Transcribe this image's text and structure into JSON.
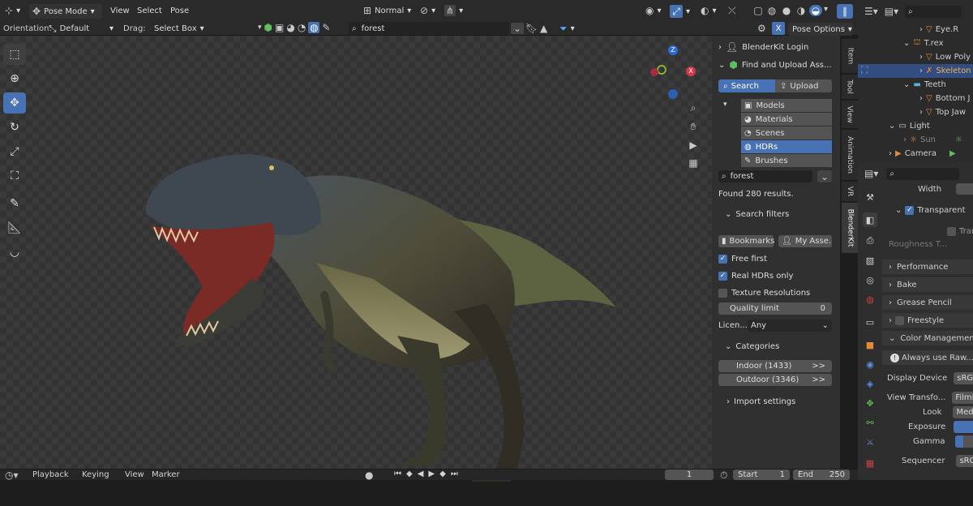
{
  "header": {
    "mode": "Pose Mode",
    "menus": [
      "View",
      "Select",
      "Pose"
    ],
    "orientation_label": "Orientation:",
    "orientation_value": "Default",
    "drag_label": "Drag:",
    "drag_value": "Select Box",
    "transform_orientation": "Normal",
    "pose_options": "Pose Options",
    "search_value": "forest"
  },
  "blenderkit": {
    "login": "BlenderKit Login",
    "find_title": "Find and Upload Ass...",
    "search_tab": "Search",
    "upload_tab": "Upload",
    "categories": [
      {
        "label": "Models",
        "icon": "cube-icon"
      },
      {
        "label": "Materials",
        "icon": "sphere-icon"
      },
      {
        "label": "Scenes",
        "icon": "scene-icon"
      },
      {
        "label": "HDRs",
        "icon": "world-icon"
      },
      {
        "label": "Brushes",
        "icon": "brush-icon"
      }
    ],
    "selected_category": "HDRs",
    "search_value": "forest",
    "results": "Found 280 results.",
    "search_filters": "Search filters",
    "bookmarks": "Bookmarks",
    "my_assets": "My Asse...",
    "free_first": "Free first",
    "real_hdrs": "Real HDRs only",
    "texture_res": "Texture Resolutions",
    "quality_label": "Quality limit",
    "quality_value": "0",
    "license_label": "Licen...",
    "license_value": "Any",
    "categories_header": "Categories",
    "cat_buttons": [
      {
        "label": "Indoor (1433)",
        "arrow": ">>"
      },
      {
        "label": "Outdoor (3346)",
        "arrow": ">>"
      }
    ],
    "import_settings": "Import settings"
  },
  "side_tabs": [
    "Item",
    "Tool",
    "View",
    "Animation",
    "VR",
    "BlenderKit"
  ],
  "outliner": [
    {
      "label": "Eye.R"
    },
    {
      "label": "T.rex"
    },
    {
      "label": "Low Poly"
    },
    {
      "label": "Skeleton"
    },
    {
      "label": "Teeth"
    },
    {
      "label": "Bottom J"
    },
    {
      "label": "Top Jaw"
    },
    {
      "label": "Light"
    },
    {
      "label": "Sun"
    },
    {
      "label": "Camera"
    }
  ],
  "properties": {
    "width": "Width",
    "transparent": "Transparent",
    "tran": "Tran",
    "roughness": "Roughness T...",
    "performance": "Performance",
    "bake": "Bake",
    "grease_pencil": "Grease Pencil",
    "freestyle": "Freestyle",
    "color_management": "Color Management",
    "always_use": "Always use Raw...sfo",
    "display_device": "Display Device",
    "display_value": "sRGB",
    "view_transform": "View Transfo...",
    "view_value": "Filmic",
    "look": "Look",
    "look_value": "Mediu",
    "exposure": "Exposure",
    "gamma": "Gamma",
    "sequencer": "Sequencer",
    "sequencer_value": "sRGB"
  },
  "timeline": {
    "menus": [
      "Playback",
      "Keying",
      "View",
      "Marker"
    ],
    "frame": "1",
    "start_label": "Start",
    "start": "1",
    "end_label": "End",
    "end": "250"
  },
  "colors": {
    "accent": "#4772b3",
    "panel": "#303030",
    "viewport": "#3a3a3a"
  }
}
